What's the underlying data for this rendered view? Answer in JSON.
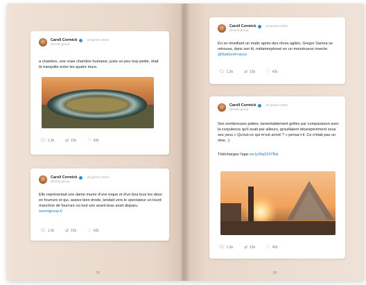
{
  "book": {
    "left_page_number": "78",
    "right_page_number": "80"
  },
  "tweets": [
    {
      "name": "Caroll Cormick",
      "date": "20 janvier 2019",
      "handle": "@cemi.group",
      "text": "a chambre, une vraie chambre humaine, juste un peu trop petite, était là tranquille entre les quatre murs.",
      "link": "",
      "replies": "1.3k",
      "retweets": "15k",
      "likes": "42k"
    },
    {
      "name": "Caroll Cormick",
      "date": "20 janvier 2019",
      "handle": "@cemi.group",
      "text": "Elle représentait une dame munie d'une toque et d'un boa tous les deux en fourrure et qui, assise bien droite, tendait vers le spectateur un lourd manchon de fourrure où tout son avant bras avait disparu.",
      "link": "seemigroup.fr",
      "replies": "1.3k",
      "retweets": "15k",
      "likes": "42k"
    },
    {
      "name": "Caroll Cormick",
      "date": "20 janvier 2019",
      "handle": "@cemi.group",
      "text": "En se réveillant un matin après des rêves agités, Gregor Samsa se retrouva, dans son lit, métamorphosé en un monstrueux insecte.",
      "link": "@NatGeoFrance",
      "replies": "1.3k",
      "retweets": "15k",
      "likes": "42k"
    },
    {
      "name": "Caroll Cormick",
      "date": "20 janvier 2019",
      "handle": "@cemi.group",
      "text": "Ses nombreuses pattes, lamentablement grêles par comparaison avec la corpulence qu'il avait par ailleurs, grouillaient désespérément sous ses yeux.« Qu'est-ce qui m'est arrivé ? » pensa-t-il. Ce n'était pas un rêve. :)",
      "text2": "Téléchargez l'app",
      "link": "ow.ly/l4q3247Bal",
      "replies": "1.3k",
      "retweets": "15k",
      "likes": "42k"
    }
  ],
  "icons": {
    "reply": "speech-bubble-icon",
    "retweet": "retweet-icon",
    "like": "heart-icon",
    "verified": "verified-badge-icon"
  },
  "colors": {
    "page": "#ead9cd",
    "card": "#ffffff",
    "link": "#2b7bc0",
    "verified": "#2b90d9"
  }
}
